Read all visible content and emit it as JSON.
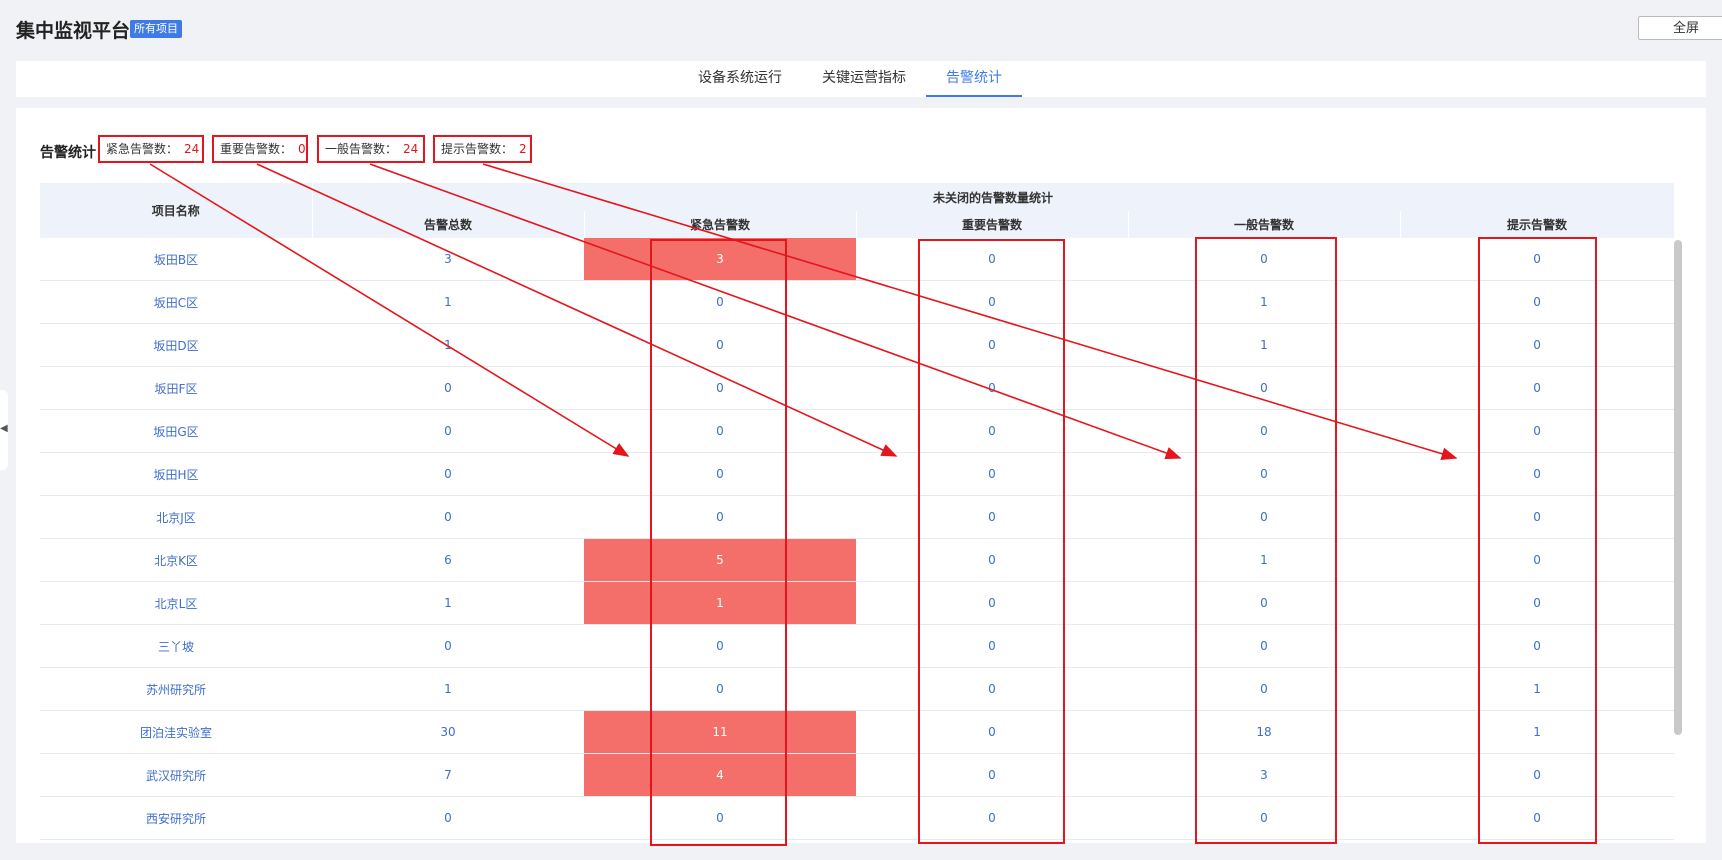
{
  "header": {
    "title": "集中监视平台",
    "badge": "所有项目",
    "fullscreen_label": "全屏"
  },
  "tabs": [
    {
      "label": "设备系统运行",
      "active": false
    },
    {
      "label": "关键运营指标",
      "active": false
    },
    {
      "label": "告警统计",
      "active": true
    }
  ],
  "summary": {
    "title": "告警统计",
    "items": [
      {
        "label": "紧急告警数：",
        "value": "24"
      },
      {
        "label": "重要告警数：",
        "value": "0"
      },
      {
        "label": "一般告警数：",
        "value": "24"
      },
      {
        "label": "提示告警数：",
        "value": "2"
      }
    ]
  },
  "table": {
    "project_header": "项目名称",
    "group_header": "未关闭的告警数量统计",
    "columns": [
      "告警总数",
      "紧急告警数",
      "重要告警数",
      "一般告警数",
      "提示告警数"
    ],
    "rows": [
      {
        "name": "坂田B区",
        "total": "3",
        "urgent": "3",
        "important": "0",
        "normal": "0",
        "hint": "0"
      },
      {
        "name": "坂田C区",
        "total": "1",
        "urgent": "0",
        "important": "0",
        "normal": "1",
        "hint": "0"
      },
      {
        "name": "坂田D区",
        "total": "1",
        "urgent": "0",
        "important": "0",
        "normal": "1",
        "hint": "0"
      },
      {
        "name": "坂田F区",
        "total": "0",
        "urgent": "0",
        "important": "0",
        "normal": "0",
        "hint": "0"
      },
      {
        "name": "坂田G区",
        "total": "0",
        "urgent": "0",
        "important": "0",
        "normal": "0",
        "hint": "0"
      },
      {
        "name": "坂田H区",
        "total": "0",
        "urgent": "0",
        "important": "0",
        "normal": "0",
        "hint": "0"
      },
      {
        "name": "北京J区",
        "total": "0",
        "urgent": "0",
        "important": "0",
        "normal": "0",
        "hint": "0"
      },
      {
        "name": "北京K区",
        "total": "6",
        "urgent": "5",
        "important": "0",
        "normal": "1",
        "hint": "0"
      },
      {
        "name": "北京L区",
        "total": "1",
        "urgent": "1",
        "important": "0",
        "normal": "0",
        "hint": "0"
      },
      {
        "name": "三丫坡",
        "total": "0",
        "urgent": "0",
        "important": "0",
        "normal": "0",
        "hint": "0"
      },
      {
        "name": "苏州研究所",
        "total": "1",
        "urgent": "0",
        "important": "0",
        "normal": "0",
        "hint": "1"
      },
      {
        "name": "团泊洼实验室",
        "total": "30",
        "urgent": "11",
        "important": "0",
        "normal": "18",
        "hint": "1"
      },
      {
        "name": "武汉研究所",
        "total": "7",
        "urgent": "4",
        "important": "0",
        "normal": "3",
        "hint": "0"
      },
      {
        "name": "西安研究所",
        "total": "0",
        "urgent": "0",
        "important": "0",
        "normal": "0",
        "hint": "0"
      }
    ]
  },
  "colors": {
    "accent": "#3f7be6",
    "highlight": "#f46e6a",
    "annotation": "#e5151d"
  }
}
